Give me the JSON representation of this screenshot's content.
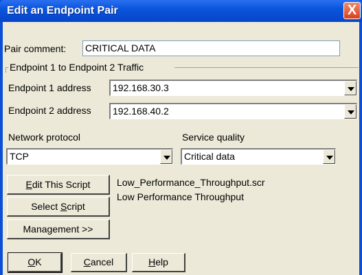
{
  "window": {
    "title": "Edit an Endpoint Pair",
    "close_glyph": "X"
  },
  "pair_comment": {
    "label": "Pair comment:",
    "value": "CRITICAL DATA"
  },
  "traffic_group": {
    "label": "Endpoint 1 to Endpoint 2 Traffic"
  },
  "endpoint1": {
    "label": "Endpoint 1 address",
    "value": "192.168.30.3"
  },
  "endpoint2": {
    "label": "Endpoint 2 address",
    "value": "192.168.40.2"
  },
  "network_protocol": {
    "label": "Network protocol",
    "value": "TCP"
  },
  "service_quality": {
    "label": "Service quality",
    "value": "Critical data"
  },
  "buttons": {
    "edit_script_prefix": "E",
    "edit_script_rest": "dit This Script",
    "select_script_prefix": "Select ",
    "select_script_ul": "S",
    "select_script_rest": "cript",
    "management_prefix": "Management",
    "management_ul": "",
    "management_rest": " >>",
    "ok_ul": "O",
    "ok_rest": "K",
    "cancel_ul": "C",
    "cancel_rest": "ancel",
    "help_ul": "H",
    "help_rest": "elp"
  },
  "script": {
    "filename": "Low_Performance_Throughput.scr",
    "description": "Low Performance Throughput"
  },
  "colors": {
    "titlebar": "#0a55dc",
    "dialog_bg": "#ece9d8",
    "close_button": "#d8401c"
  }
}
